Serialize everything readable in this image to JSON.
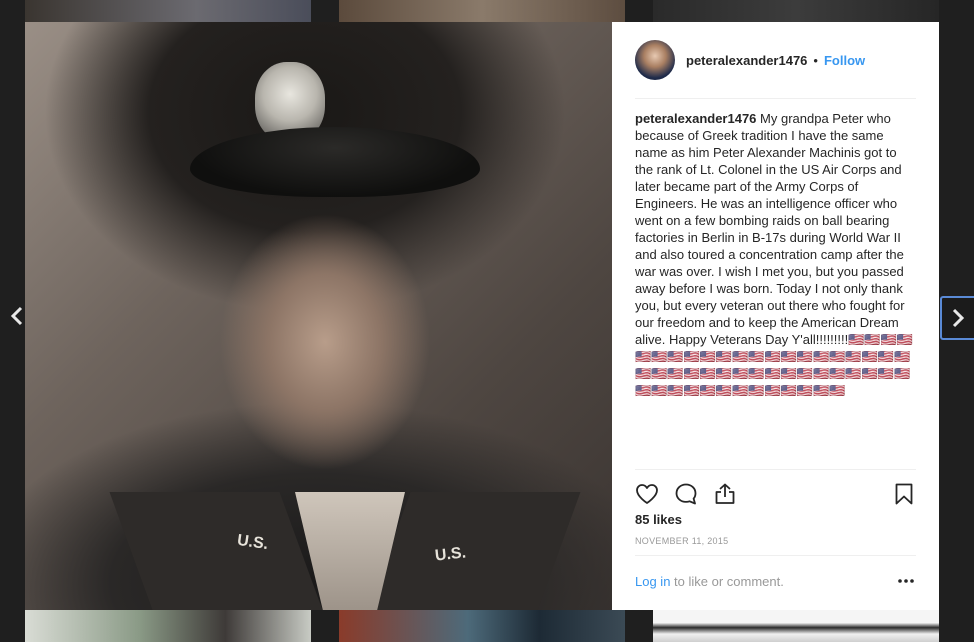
{
  "post": {
    "username": "peteralexander1476",
    "separator": "•",
    "follow_label": "Follow",
    "caption_text": "My grandpa Peter who because of Greek tradition I have the same name as him Peter Alexander Machinis got to the rank of Lt. Colonel in the US Air Corps and later became part of the Army Corps of Engineers. He was an intelligence officer who went on a few bombing raids on ball bearing factories in Berlin in B-17s during World War II and also toured a concentration camp after the war was over. I wish I met you, but you passed away before I was born. Today I not only thank you, but every veteran out there who fought for our freedom and to keep the American Dream alive. Happy Veterans Day Y'all!!!!!!!!!🇺🇸🇺🇸🇺🇸🇺🇸🇺🇸🇺🇸🇺🇸🇺🇸🇺🇸🇺🇸🇺🇸🇺🇸🇺🇸🇺🇸🇺🇸🇺🇸🇺🇸🇺🇸🇺🇸🇺🇸🇺🇸🇺🇸🇺🇸🇺🇸🇺🇸🇺🇸🇺🇸🇺🇸🇺🇸🇺🇸🇺🇸🇺🇸🇺🇸🇺🇸🇺🇸🇺🇸🇺🇸🇺🇸🇺🇸🇺🇸🇺🇸🇺🇸🇺🇸🇺🇸🇺🇸🇺🇸🇺🇸🇺🇸🇺🇸🇺🇸🇺🇸",
    "likes": "85 likes",
    "date": "NOVEMBER 11, 2015",
    "photo_text": {
      "left_insignia": "U.S.",
      "right_insignia": "U.S."
    }
  },
  "footer": {
    "login_link": "Log in",
    "login_suffix": " to like or comment."
  },
  "icons": {
    "prev": "chevron-left-icon",
    "next": "chevron-right-icon",
    "like": "heart-icon",
    "comment": "comment-icon",
    "share": "share-icon",
    "save": "bookmark-icon",
    "more": "more-icon"
  },
  "colors": {
    "link_blue": "#3897f0",
    "text": "#262626",
    "muted": "#999999"
  }
}
